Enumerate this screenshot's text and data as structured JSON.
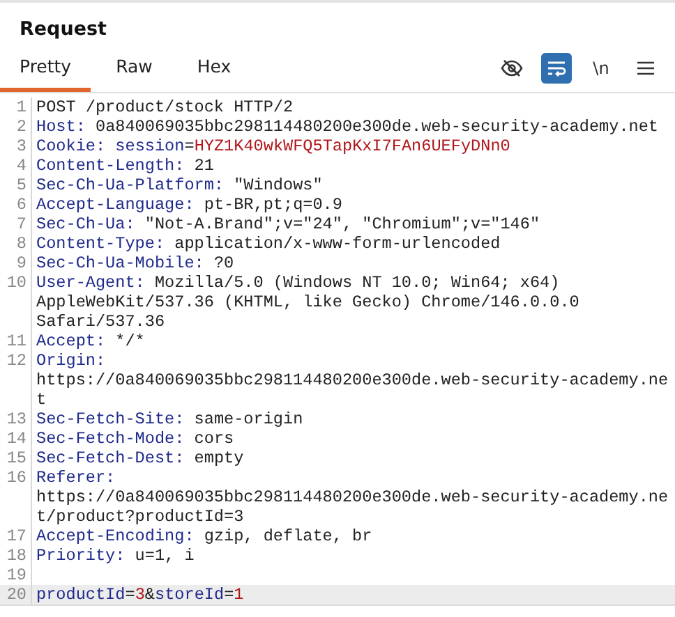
{
  "panel": {
    "title": "Request"
  },
  "tabs": [
    {
      "label": "Pretty",
      "selected": true
    },
    {
      "label": "Raw",
      "selected": false
    },
    {
      "label": "Hex",
      "selected": false
    }
  ],
  "toolbar": [
    {
      "kind": "hide",
      "selected": false
    },
    {
      "kind": "wrap",
      "selected": true
    },
    {
      "kind": "newline",
      "label": "\\n",
      "selected": false
    },
    {
      "kind": "menu",
      "selected": false
    }
  ],
  "lines": [
    {
      "number": "1",
      "rows": [
        [
          {
            "kind": "plain",
            "text": "POST /product/stock HTTP/2"
          }
        ]
      ]
    },
    {
      "number": "2",
      "rows": [
        [
          {
            "kind": "key",
            "text": "Host:"
          },
          {
            "kind": "plain",
            "text": " 0a840069035bbc298114480200e300de.web-security-academy.net"
          }
        ]
      ]
    },
    {
      "number": "3",
      "rows": [
        [
          {
            "kind": "key",
            "text": "Cookie:"
          },
          {
            "kind": "plain",
            "text": " "
          },
          {
            "kind": "name",
            "text": "session"
          },
          {
            "kind": "plain",
            "text": "="
          },
          {
            "kind": "value",
            "text": "HYZ1K40wkWFQ5TapKxI7FAn6UEFyDNn0"
          }
        ]
      ]
    },
    {
      "number": "4",
      "rows": [
        [
          {
            "kind": "key",
            "text": "Content-Length:"
          },
          {
            "kind": "plain",
            "text": " 21"
          }
        ]
      ]
    },
    {
      "number": "5",
      "rows": [
        [
          {
            "kind": "key",
            "text": "Sec-Ch-Ua-Platform:"
          },
          {
            "kind": "plain",
            "text": " \"Windows\""
          }
        ]
      ]
    },
    {
      "number": "6",
      "rows": [
        [
          {
            "kind": "key",
            "text": "Accept-Language:"
          },
          {
            "kind": "plain",
            "text": " pt-BR,pt;q=0.9"
          }
        ]
      ]
    },
    {
      "number": "7",
      "rows": [
        [
          {
            "kind": "key",
            "text": "Sec-Ch-Ua:"
          },
          {
            "kind": "plain",
            "text": " \"Not-A.Brand\";v=\"24\", \"Chromium\";v=\"146\""
          }
        ]
      ]
    },
    {
      "number": "8",
      "rows": [
        [
          {
            "kind": "key",
            "text": "Content-Type:"
          },
          {
            "kind": "plain",
            "text": " application/x-www-form-urlencoded"
          }
        ]
      ]
    },
    {
      "number": "9",
      "rows": [
        [
          {
            "kind": "key",
            "text": "Sec-Ch-Ua-Mobile:"
          },
          {
            "kind": "plain",
            "text": " ?0"
          }
        ]
      ]
    },
    {
      "number": "10",
      "rows": [
        [
          {
            "kind": "key",
            "text": "User-Agent:"
          },
          {
            "kind": "plain",
            "text": " Mozilla/5.0 (Windows NT 10.0; Win64; x64)"
          }
        ],
        [
          {
            "kind": "plain",
            "text": "AppleWebKit/537.36 (KHTML, like Gecko) Chrome/146.0.0.0"
          }
        ],
        [
          {
            "kind": "plain",
            "text": "Safari/537.36"
          }
        ]
      ]
    },
    {
      "number": "11",
      "rows": [
        [
          {
            "kind": "key",
            "text": "Accept:"
          },
          {
            "kind": "plain",
            "text": " */*"
          }
        ]
      ]
    },
    {
      "number": "12",
      "rows": [
        [
          {
            "kind": "key",
            "text": "Origin:"
          }
        ],
        [
          {
            "kind": "plain",
            "text": "https://0a840069035bbc298114480200e300de.web-security-academy.ne"
          }
        ],
        [
          {
            "kind": "plain",
            "text": "t"
          }
        ]
      ]
    },
    {
      "number": "13",
      "rows": [
        [
          {
            "kind": "key",
            "text": "Sec-Fetch-Site:"
          },
          {
            "kind": "plain",
            "text": " same-origin"
          }
        ]
      ]
    },
    {
      "number": "14",
      "rows": [
        [
          {
            "kind": "key",
            "text": "Sec-Fetch-Mode:"
          },
          {
            "kind": "plain",
            "text": " cors"
          }
        ]
      ]
    },
    {
      "number": "15",
      "rows": [
        [
          {
            "kind": "key",
            "text": "Sec-Fetch-Dest:"
          },
          {
            "kind": "plain",
            "text": " empty"
          }
        ]
      ]
    },
    {
      "number": "16",
      "rows": [
        [
          {
            "kind": "key",
            "text": "Referer:"
          }
        ],
        [
          {
            "kind": "plain",
            "text": "https://0a840069035bbc298114480200e300de.web-security-academy.ne"
          }
        ],
        [
          {
            "kind": "plain",
            "text": "t/product?productId=3"
          }
        ]
      ]
    },
    {
      "number": "17",
      "rows": [
        [
          {
            "kind": "key",
            "text": "Accept-Encoding:"
          },
          {
            "kind": "plain",
            "text": " gzip, deflate, br"
          }
        ]
      ]
    },
    {
      "number": "18",
      "rows": [
        [
          {
            "kind": "key",
            "text": "Priority:"
          },
          {
            "kind": "plain",
            "text": " u=1, i"
          }
        ]
      ]
    },
    {
      "number": "19",
      "rows": [
        []
      ]
    },
    {
      "number": "20",
      "selected": true,
      "rows": [
        [
          {
            "kind": "name",
            "text": "productId"
          },
          {
            "kind": "plain",
            "text": "="
          },
          {
            "kind": "value",
            "text": "3"
          },
          {
            "kind": "plain",
            "text": "&"
          },
          {
            "kind": "name",
            "text": "storeId"
          },
          {
            "kind": "plain",
            "text": "="
          },
          {
            "kind": "value",
            "text": "1"
          }
        ]
      ]
    }
  ]
}
